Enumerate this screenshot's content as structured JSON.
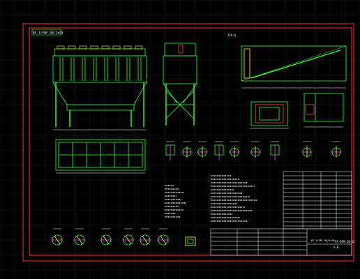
{
  "drawing": {
    "title_left": "BF-1/FBF-96/1x5A",
    "top_right_label": "ISO-A",
    "drawing_number": "FF-BFM-20-11",
    "sheet_scale": "A-B",
    "block_label": "BF-1/FBF-96/1x5A"
  },
  "colors": {
    "background": "#000000",
    "grid": "#1c1c1c",
    "frame": "#ff2a2a",
    "line": "#30ff30",
    "yellow": "#ffff30",
    "white": "#ffffff",
    "cyan": "#30ffff",
    "magenta": "#ff40ff"
  },
  "icons": [
    "detail-section-icon"
  ]
}
